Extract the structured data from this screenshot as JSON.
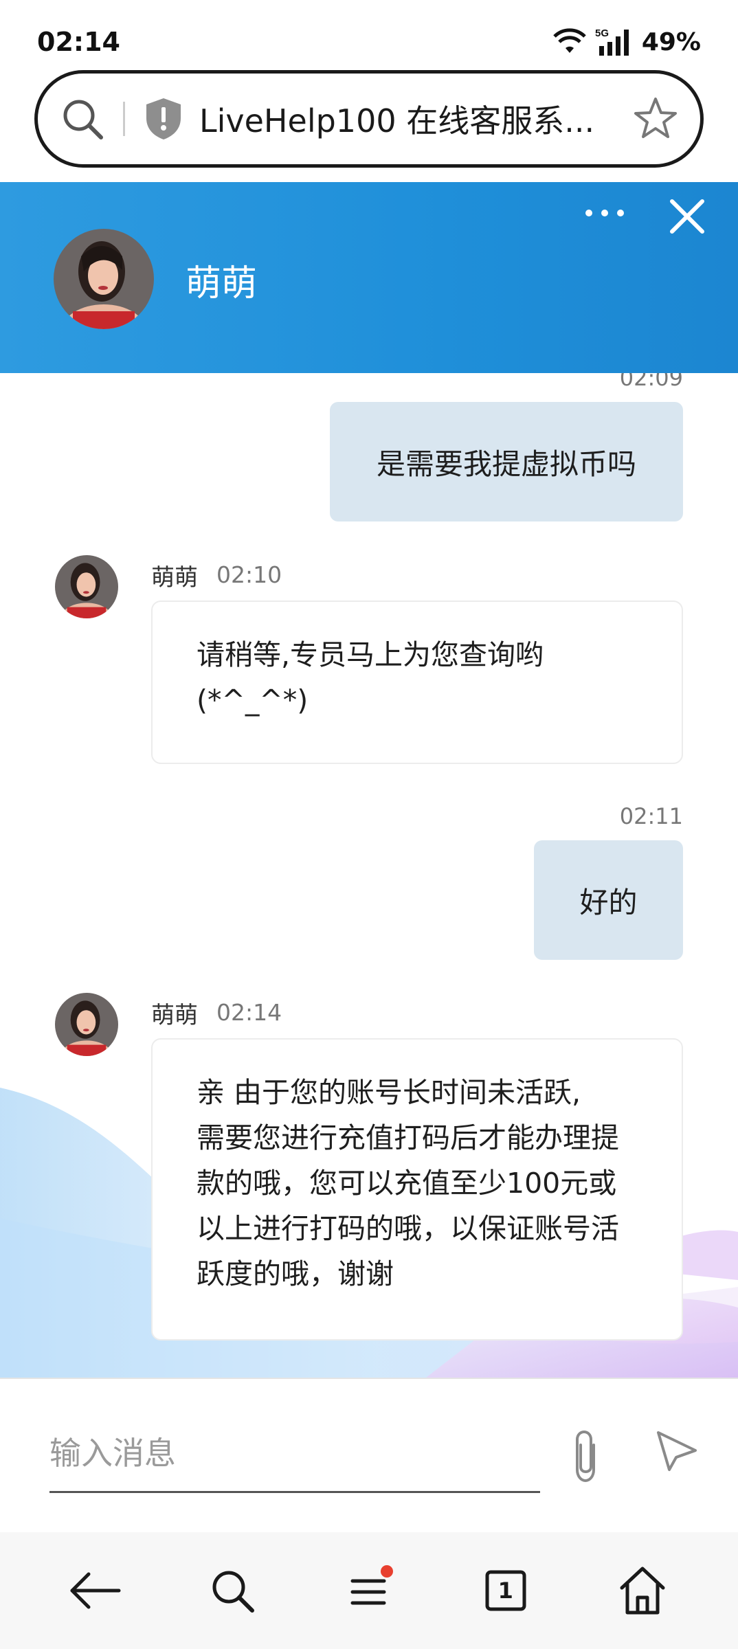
{
  "status_bar": {
    "time": "02:14",
    "network": "5G",
    "battery": "49%"
  },
  "browser": {
    "url_title": "LiveHelp100 在线客服系...",
    "tab_count": "1"
  },
  "chat_header": {
    "agent_name": "萌萌"
  },
  "messages": [
    {
      "direction": "out",
      "time": "02:09",
      "text": "是需要我提虚拟币吗"
    },
    {
      "direction": "in",
      "sender": "萌萌",
      "time": "02:10",
      "lines": [
        "请稍等,专员马上为您查询哟",
        "(*^_^*)"
      ]
    },
    {
      "direction": "out",
      "time": "02:11",
      "text": "好的"
    },
    {
      "direction": "in",
      "sender": "萌萌",
      "time": "02:14",
      "lines": [
        "亲 由于您的账号长时间未活跃,",
        "需要您进行充值打码后才能办理提",
        "款的哦，您可以充值至少100元或",
        "以上进行打码的哦，以保证账号活",
        "跃度的哦，谢谢"
      ]
    }
  ],
  "input": {
    "placeholder": "输入消息",
    "value": ""
  },
  "colors": {
    "header_blue": "#2196db",
    "bubble_out": "#d9e6f0",
    "notification_dot": "#e8402f"
  },
  "icons": {
    "header": [
      "more-icon",
      "close-icon"
    ],
    "input": [
      "attach-icon",
      "send-icon"
    ],
    "nav": [
      "back-icon",
      "search-icon",
      "menu-icon",
      "tabs-icon",
      "home-icon"
    ]
  }
}
